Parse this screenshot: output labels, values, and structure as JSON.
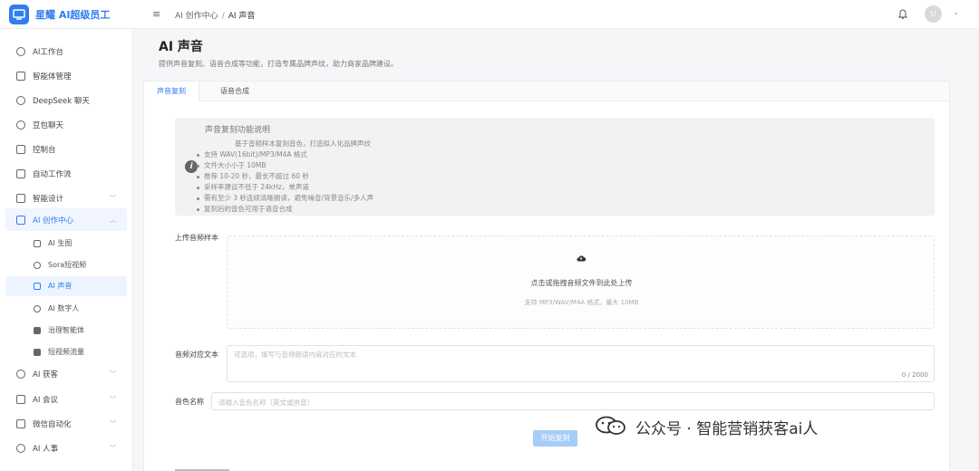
{
  "header": {
    "app_title": "星耀 AI超级员工",
    "menu_icon": "hamburger-icon",
    "breadcrumb": [
      "AI 创作中心",
      "AI 声音"
    ],
    "avatar_text": "U"
  },
  "sidebar": {
    "items": [
      {
        "label": "AI工作台",
        "icon": "chat-icon"
      },
      {
        "label": "智能体管理",
        "icon": "list-icon"
      },
      {
        "label": "DeepSeek 聊天",
        "icon": "chat-icon"
      },
      {
        "label": "豆包聊天",
        "icon": "chat-icon"
      },
      {
        "label": "控制台",
        "icon": "monitor-icon"
      },
      {
        "label": "自动工作流",
        "icon": "workflow-icon"
      },
      {
        "label": "智能设计",
        "icon": "design-icon"
      },
      {
        "label": "AI 创作中心",
        "icon": "video-icon"
      }
    ],
    "sub_items": [
      {
        "label": "AI 生图",
        "icon": "image-icon"
      },
      {
        "label": "Sora短视频",
        "icon": "play-icon"
      },
      {
        "label": "AI 声音",
        "icon": "headphone-icon"
      },
      {
        "label": "AI 数字人",
        "icon": "user-icon"
      },
      {
        "label": "治理智能体",
        "icon": "grid-icon"
      },
      {
        "label": "短视频流量",
        "icon": "film-icon"
      }
    ],
    "bottom_items": [
      {
        "label": "AI 获客",
        "icon": "target-icon"
      },
      {
        "label": "AI 会议",
        "icon": "mic-icon"
      },
      {
        "label": "微信自动化",
        "icon": "wechat-icon"
      },
      {
        "label": "AI 人事",
        "icon": "user-icon"
      }
    ]
  },
  "page": {
    "title": "AI 声音",
    "description": "提供声音复刻、语音合成等功能，打造专属品牌声纹，助力商家品牌建设。"
  },
  "tabs": [
    "声音复刻",
    "语音合成"
  ],
  "info": {
    "title": "声音复刻功能说明",
    "lines": [
      "基于音频样本复刻音色，打造拟人化品牌声纹",
      "支持 WAV(16bit)/MP3/M4A 格式",
      "文件大小小于 10MB",
      "推荐 10-20 秒，最长不超过 60 秒",
      "采样率建议不低于 24kHz，单声道",
      "需有至少 3 秒连续清晰朗读，避免噪音/背景音乐/多人声",
      "复刻后的音色可用于语音合成"
    ]
  },
  "form": {
    "upload_label": "上传音频样本",
    "upload_text": "点击或拖拽音频文件到此处上传",
    "upload_hint": "支持 MP3/WAV/M4A 格式，最大 10MB",
    "text_label": "音频对应文本",
    "text_placeholder": "可选项，填写与音频朗读内容对应的文本",
    "text_count": "0 / 2000",
    "name_label": "音色名称",
    "name_placeholder": "请输入音色名称（英文或拼音）",
    "start_button": "开始复刻"
  },
  "watermark": "公众号 · 智能营销获客ai人",
  "colors": {
    "accent": "#2f7df0",
    "button_disabled": "#a6cdf7"
  }
}
